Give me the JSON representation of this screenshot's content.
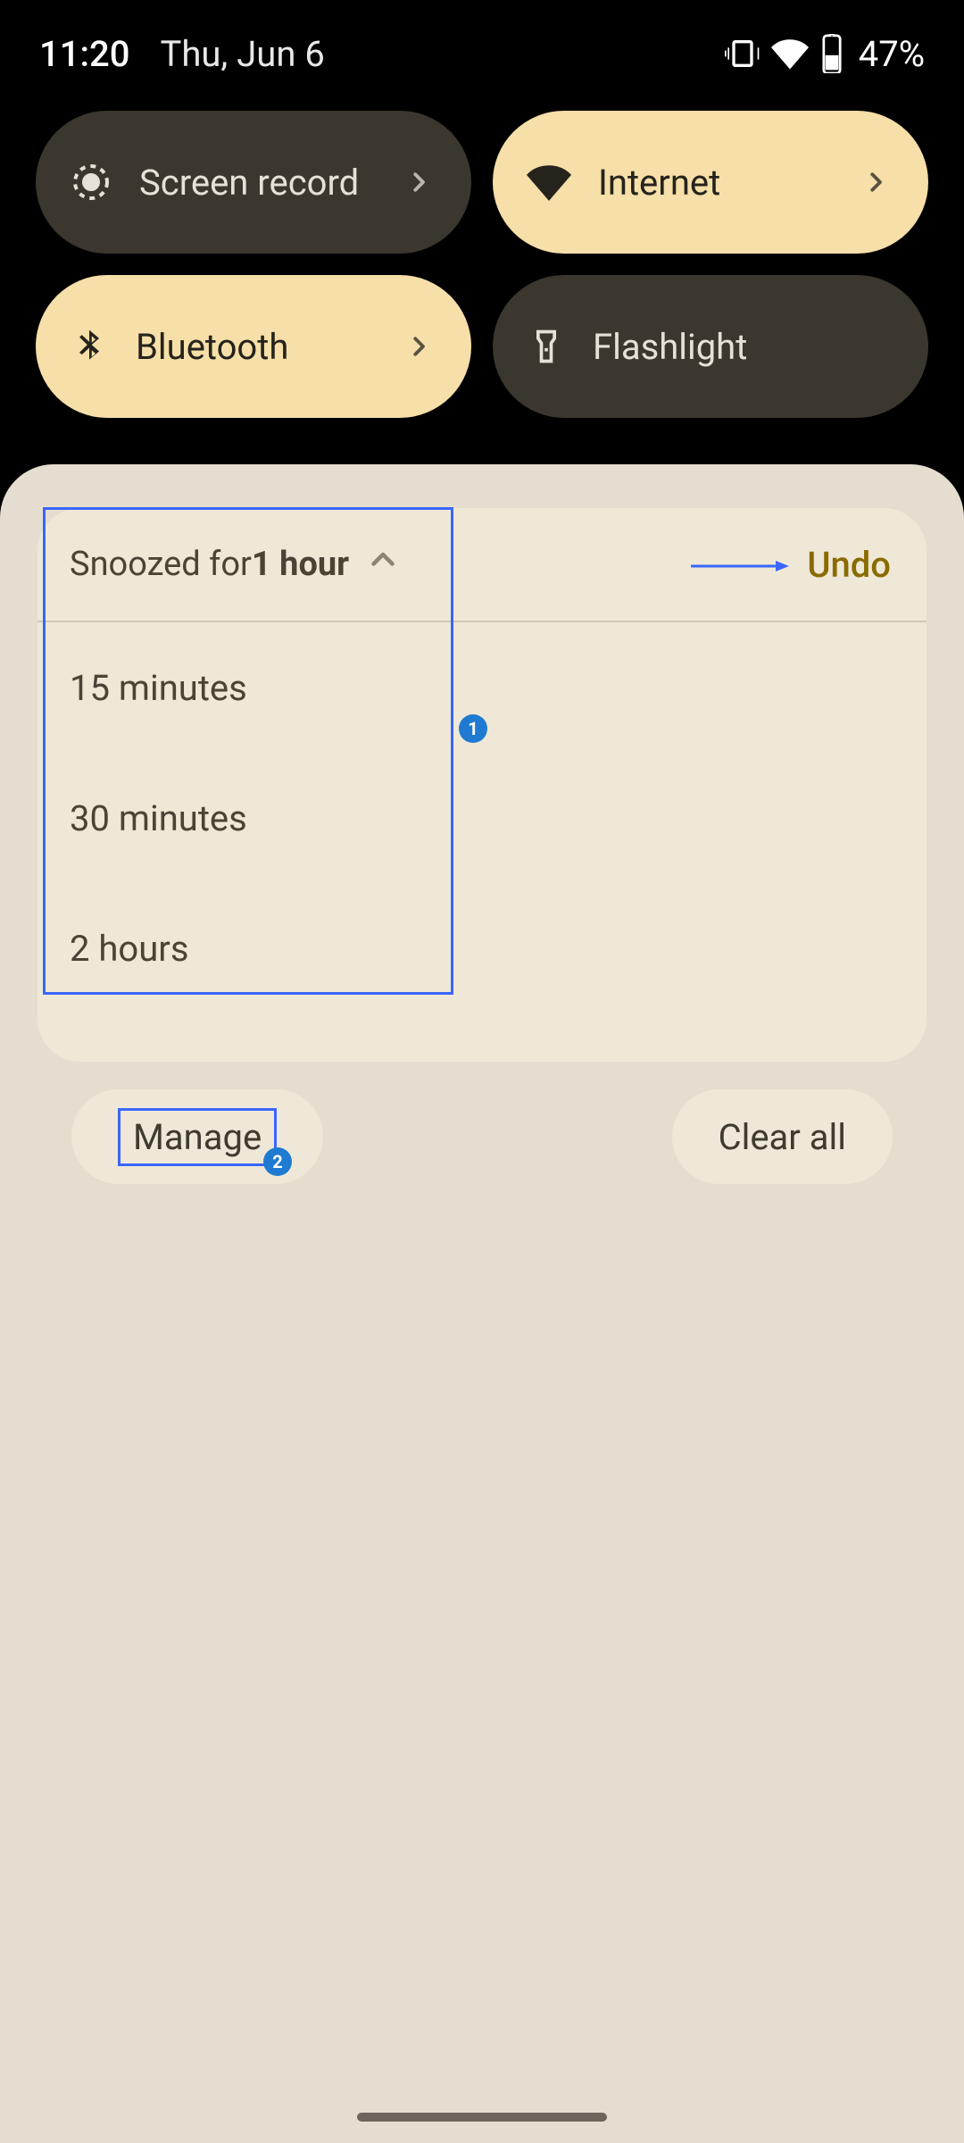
{
  "status": {
    "time": "11:20",
    "date": "Thu, Jun 6",
    "battery_pct": "47%"
  },
  "qs": {
    "screen_record": "Screen record",
    "internet": "Internet",
    "bluetooth": "Bluetooth",
    "flashlight": "Flashlight"
  },
  "snooze": {
    "prefix": "Snoozed for ",
    "duration": "1 hour",
    "undo": "Undo",
    "options": {
      "opt15": "15 minutes",
      "opt30": "30 minutes",
      "opt2h": "2 hours"
    }
  },
  "badges": {
    "b1": "1",
    "b2": "2"
  },
  "footer": {
    "manage": "Manage",
    "clear_all": "Clear all"
  }
}
